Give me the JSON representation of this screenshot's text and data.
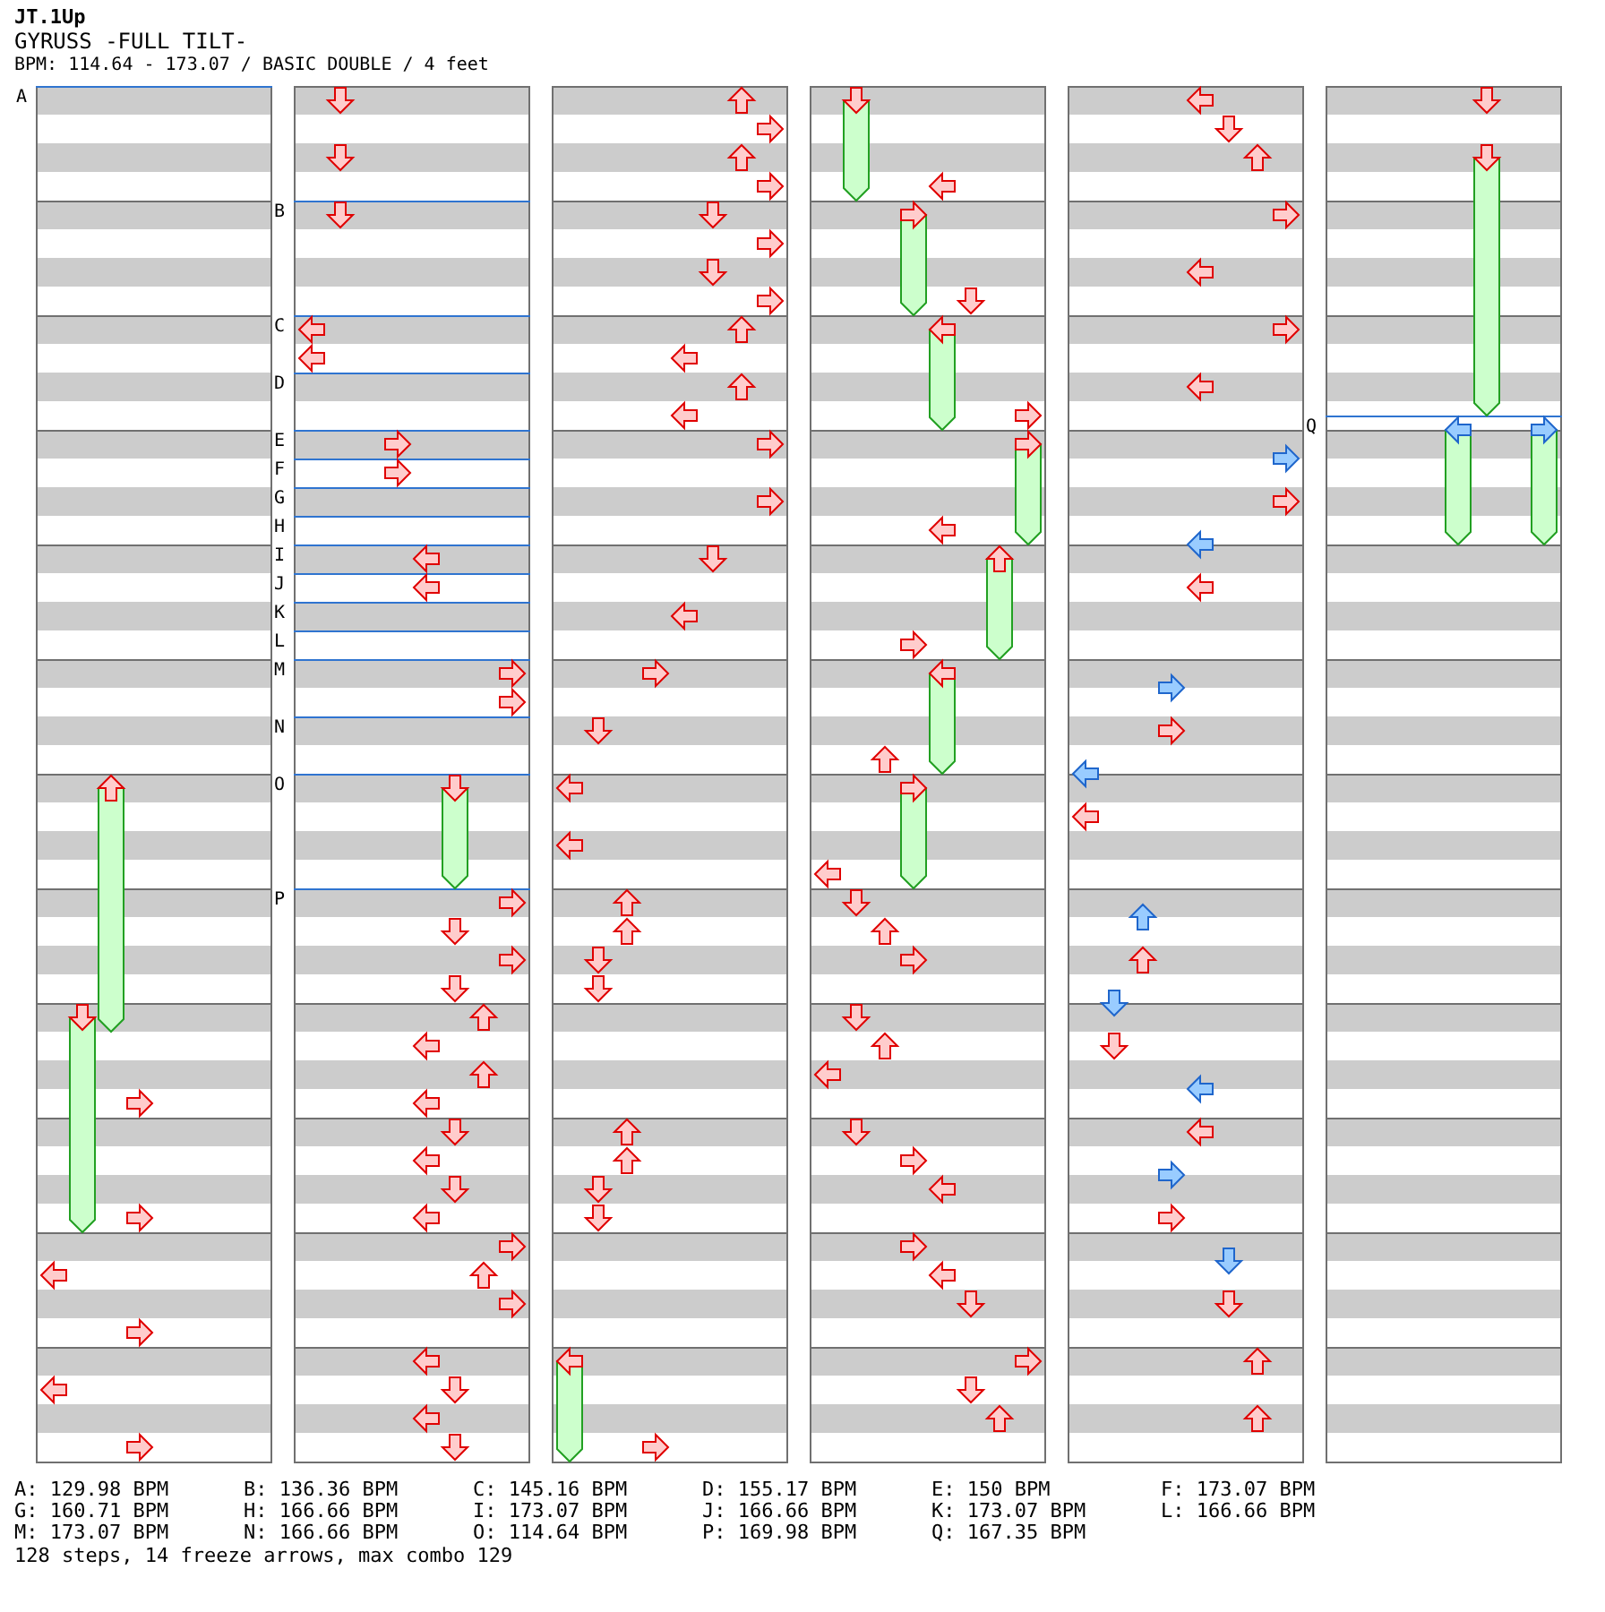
{
  "header": {
    "author": "JT.1Up",
    "title": "GYRUSS -FULL TILT-",
    "info": "BPM: 114.64 - 173.07 / BASIC DOUBLE / 4 feet"
  },
  "columns": [
    {
      "measures": [
        {
          "rows": [
            {
              "bpm_mark": "A"
            },
            {},
            {},
            {},
            {},
            {},
            {},
            {}
          ]
        },
        {
          "rows": [
            {},
            {},
            {},
            {},
            {},
            {},
            {},
            {}
          ]
        },
        {
          "rows": [
            {},
            {},
            {},
            {},
            {},
            {},
            {},
            {}
          ]
        },
        {
          "rows": [
            {},
            {},
            {},
            {},
            {},
            {},
            {},
            {}
          ]
        },
        {
          "rows": [
            {},
            {},
            {},
            {},
            {},
            {},
            {},
            {}
          ]
        },
        {
          "rows": [
            {},
            {},
            {},
            {},
            {},
            {},
            {},
            {}
          ]
        },
        {
          "rows": [
            {
              "p1_up": {
                "kind": "freeze",
                "color": "#ffcccc"
              }
            },
            {},
            {},
            {},
            {},
            {},
            {},
            {}
          ]
        },
        {
          "rows": [
            {},
            {},
            {},
            {},
            {},
            {},
            {},
            {}
          ]
        },
        {
          "rows": [
            {
              "p1_down": {
                "kind": "freeze",
                "color": "#ffcccc"
              },
              "p1_up": {
                "kind": "freeze_end"
              }
            },
            {},
            {},
            {},
            {},
            {},
            {
              "p1_right": {
                "kind": "tap",
                "color": "#ffcccc"
              }
            },
            {}
          ]
        },
        {
          "rows": [
            {},
            {},
            {},
            {},
            {},
            {},
            {
              "p1_down": {
                "kind": "freeze_end"
              },
              "p1_right": {
                "kind": "tap",
                "color": "#ffcccc"
              }
            },
            {}
          ]
        },
        {
          "rows": [
            {},
            {},
            {
              "p1_left": {
                "kind": "tap",
                "color": "#ffcccc"
              }
            },
            {},
            {},
            {},
            {
              "p1_right": {
                "kind": "tap",
                "color": "#ffcccc"
              }
            },
            {}
          ]
        },
        {
          "rows": [
            {},
            {},
            {
              "p1_left": {
                "kind": "tap",
                "color": "#ffcccc"
              }
            },
            {},
            {},
            {},
            {
              "p1_right": {
                "kind": "tap",
                "color": "#ffcccc"
              }
            },
            {}
          ]
        }
      ]
    },
    {
      "measures": [
        {
          "rows": [
            {
              "p1_down": {
                "kind": "tap",
                "color": "#ffcccc"
              }
            },
            {},
            {},
            {},
            {
              "p1_down": {
                "kind": "tap",
                "color": "#ffcccc"
              }
            },
            {},
            {},
            {}
          ]
        },
        {
          "rows": [
            {
              "bpm_mark": "B",
              "p1_down": {
                "kind": "tap",
                "color": "#ffcccc"
              }
            },
            {},
            {},
            {},
            {},
            {},
            {},
            {}
          ]
        },
        {
          "rows": [
            {
              "bpm_mark": "C",
              "p1_left": {
                "kind": "tap",
                "color": "#ffcccc"
              }
            },
            {},
            {
              "p1_left": {
                "kind": "tap",
                "color": "#ffcccc"
              }
            },
            {},
            {
              "bpm_mark": "D"
            },
            {},
            {},
            {}
          ]
        },
        {
          "rows": [
            {
              "bpm_mark": "E",
              "p1_right": {
                "kind": "tap",
                "color": "#ffcccc"
              }
            },
            {},
            {
              "bpm_mark": "F",
              "p1_right": {
                "kind": "tap",
                "color": "#ffcccc"
              }
            },
            {},
            {
              "bpm_mark": "G"
            },
            {},
            {
              "bpm_mark": "H"
            },
            {}
          ]
        },
        {
          "rows": [
            {
              "bpm_mark": "I",
              "p2_left": {
                "kind": "tap",
                "color": "#ffcccc"
              }
            },
            {},
            {
              "bpm_mark": "J",
              "p2_left": {
                "kind": "tap",
                "color": "#ffcccc"
              }
            },
            {},
            {
              "bpm_mark": "K"
            },
            {},
            {
              "bpm_mark": "L"
            },
            {}
          ]
        },
        {
          "rows": [
            {
              "bpm_mark": "M",
              "p2_right": {
                "kind": "tap",
                "color": "#ffcccc"
              }
            },
            {},
            {
              "p2_right": {
                "kind": "tap",
                "color": "#ffcccc"
              }
            },
            {},
            {
              "bpm_mark": "N"
            },
            {},
            {},
            {}
          ]
        },
        {
          "rows": [
            {
              "bpm_mark": "O",
              "p2_down": {
                "kind": "freeze",
                "color": "#ffcccc"
              }
            },
            {},
            {},
            {},
            {},
            {},
            {
              "p2_down": {
                "kind": "freeze_end"
              }
            },
            {}
          ]
        },
        {
          "rows": [
            {
              "bpm_mark": "P",
              "p2_right": {
                "kind": "tap",
                "color": "#ffcccc"
              }
            },
            {},
            {
              "p2_down": {
                "kind": "tap",
                "color": "#ffcccc"
              }
            },
            {},
            {
              "p2_right": {
                "kind": "tap",
                "color": "#ffcccc"
              }
            },
            {},
            {
              "p2_down": {
                "kind": "tap",
                "color": "#ffcccc"
              }
            },
            {}
          ]
        },
        {
          "rows": [
            {
              "p2_up": {
                "kind": "tap",
                "color": "#ffcccc"
              }
            },
            {},
            {
              "p2_left": {
                "kind": "tap",
                "color": "#ffcccc"
              }
            },
            {},
            {
              "p2_up": {
                "kind": "tap",
                "color": "#ffcccc"
              }
            },
            {},
            {
              "p2_left": {
                "kind": "tap",
                "color": "#ffcccc"
              }
            },
            {}
          ]
        },
        {
          "rows": [
            {
              "p2_down": {
                "kind": "tap",
                "color": "#ffcccc"
              }
            },
            {},
            {
              "p2_left": {
                "kind": "tap",
                "color": "#ffcccc"
              }
            },
            {},
            {
              "p2_down": {
                "kind": "tap",
                "color": "#ffcccc"
              }
            },
            {},
            {
              "p2_left": {
                "kind": "tap",
                "color": "#ffcccc"
              }
            },
            {}
          ]
        },
        {
          "rows": [
            {
              "p2_right": {
                "kind": "tap",
                "color": "#ffcccc"
              }
            },
            {},
            {
              "p2_up": {
                "kind": "tap",
                "color": "#ffcccc"
              }
            },
            {},
            {
              "p2_right": {
                "kind": "tap",
                "color": "#ffcccc"
              }
            },
            {},
            {},
            {}
          ]
        },
        {
          "rows": [
            {
              "p2_left": {
                "kind": "tap",
                "color": "#ffcccc"
              }
            },
            {},
            {
              "p2_down": {
                "kind": "tap",
                "color": "#ffcccc"
              }
            },
            {},
            {
              "p2_left": {
                "kind": "tap",
                "color": "#ffcccc"
              }
            },
            {},
            {
              "p2_down": {
                "kind": "tap",
                "color": "#ffcccc"
              }
            },
            {}
          ]
        }
      ]
    },
    {
      "measures": [
        {
          "rows": [
            {
              "p2_up": {
                "kind": "tap",
                "color": "#ffcccc"
              }
            },
            {},
            {
              "p2_right": {
                "kind": "tap",
                "color": "#ffcccc"
              }
            },
            {},
            {
              "p2_up": {
                "kind": "tap",
                "color": "#ffcccc"
              }
            },
            {},
            {
              "p2_right": {
                "kind": "tap",
                "color": "#ffcccc"
              }
            },
            {}
          ]
        },
        {
          "rows": [
            {
              "p2_down": {
                "kind": "tap",
                "color": "#ffcccc"
              }
            },
            {},
            {
              "p2_right": {
                "kind": "tap",
                "color": "#ffcccc"
              }
            },
            {},
            {
              "p2_down": {
                "kind": "tap",
                "color": "#ffcccc"
              }
            },
            {},
            {
              "p2_right": {
                "kind": "tap",
                "color": "#ffcccc"
              }
            },
            {}
          ]
        },
        {
          "rows": [
            {
              "p2_up": {
                "kind": "tap",
                "color": "#ffcccc"
              }
            },
            {},
            {
              "p2_left": {
                "kind": "tap",
                "color": "#ffcccc"
              }
            },
            {},
            {
              "p2_up": {
                "kind": "tap",
                "color": "#ffcccc"
              }
            },
            {},
            {
              "p2_left": {
                "kind": "tap",
                "color": "#ffcccc"
              }
            },
            {}
          ]
        },
        {
          "rows": [
            {
              "p2_right": {
                "kind": "tap",
                "color": "#ffcccc"
              }
            },
            {},
            {},
            {},
            {
              "p2_right": {
                "kind": "tap",
                "color": "#ffcccc"
              }
            },
            {},
            {},
            {}
          ]
        },
        {
          "rows": [
            {
              "p2_down": {
                "kind": "tap",
                "color": "#ffcccc"
              }
            },
            {},
            {},
            {},
            {
              "p2_left": {
                "kind": "tap",
                "color": "#ffcccc"
              }
            },
            {},
            {},
            {}
          ]
        },
        {
          "rows": [
            {
              "p1_right": {
                "kind": "tap",
                "color": "#ffcccc"
              }
            },
            {},
            {},
            {},
            {
              "p1_down": {
                "kind": "tap",
                "color": "#ffcccc"
              }
            },
            {},
            {},
            {}
          ]
        },
        {
          "rows": [
            {
              "p1_left": {
                "kind": "tap",
                "color": "#ffcccc"
              }
            },
            {},
            {},
            {},
            {
              "p1_left": {
                "kind": "tap",
                "color": "#ffcccc"
              }
            },
            {},
            {},
            {}
          ]
        },
        {
          "rows": [
            {
              "p1_up": {
                "kind": "tap",
                "color": "#ffcccc"
              }
            },
            {},
            {
              "p1_up": {
                "kind": "tap",
                "color": "#ffcccc"
              }
            },
            {},
            {
              "p1_down": {
                "kind": "tap",
                "color": "#ffcccc"
              }
            },
            {},
            {
              "p1_down": {
                "kind": "tap",
                "color": "#ffcccc"
              }
            },
            {}
          ]
        },
        {
          "rows": [
            {},
            {},
            {},
            {},
            {},
            {},
            {},
            {}
          ]
        },
        {
          "rows": [
            {
              "p1_up": {
                "kind": "tap",
                "color": "#ffcccc"
              }
            },
            {},
            {
              "p1_up": {
                "kind": "tap",
                "color": "#ffcccc"
              }
            },
            {},
            {
              "p1_down": {
                "kind": "tap",
                "color": "#ffcccc"
              }
            },
            {},
            {
              "p1_down": {
                "kind": "tap",
                "color": "#ffcccc"
              }
            },
            {}
          ]
        },
        {
          "rows": [
            {},
            {},
            {},
            {},
            {},
            {},
            {},
            {}
          ]
        },
        {
          "rows": [
            {
              "p1_left": {
                "kind": "freeze",
                "color": "#ffcccc"
              }
            },
            {},
            {},
            {},
            {},
            {},
            {
              "p1_left": {
                "kind": "freeze_end"
              },
              "p1_right": {
                "kind": "tap",
                "color": "#ffcccc"
              }
            },
            {}
          ]
        }
      ]
    },
    {
      "measures": [
        {
          "rows": [
            {
              "p1_down": {
                "kind": "freeze",
                "color": "#ffcccc"
              }
            },
            {},
            {},
            {},
            {},
            {},
            {
              "p1_down": {
                "kind": "freeze_end"
              },
              "p2_left": {
                "kind": "tap",
                "color": "#ffcccc"
              }
            },
            {}
          ]
        },
        {
          "rows": [
            {
              "p1_right": {
                "kind": "freeze",
                "color": "#ffcccc"
              }
            },
            {},
            {},
            {},
            {},
            {},
            {
              "p1_right": {
                "kind": "freeze_end"
              },
              "p2_down": {
                "kind": "tap",
                "color": "#ffcccc"
              }
            },
            {}
          ]
        },
        {
          "rows": [
            {
              "p2_left": {
                "kind": "freeze",
                "color": "#ffcccc"
              }
            },
            {},
            {},
            {},
            {},
            {},
            {
              "p2_left": {
                "kind": "freeze_end"
              },
              "p2_right": {
                "kind": "tap",
                "color": "#ffcccc"
              }
            },
            {}
          ]
        },
        {
          "rows": [
            {
              "p2_right": {
                "kind": "freeze",
                "color": "#ffcccc"
              }
            },
            {},
            {},
            {},
            {},
            {},
            {
              "p2_right": {
                "kind": "freeze_end"
              },
              "p2_left": {
                "kind": "tap",
                "color": "#ffcccc"
              }
            },
            {}
          ]
        },
        {
          "rows": [
            {
              "p2_up": {
                "kind": "freeze",
                "color": "#ffcccc"
              }
            },
            {},
            {},
            {},
            {},
            {},
            {
              "p2_up": {
                "kind": "freeze_end"
              },
              "p1_right": {
                "kind": "tap",
                "color": "#ffcccc"
              }
            },
            {}
          ]
        },
        {
          "rows": [
            {
              "p2_left": {
                "kind": "freeze",
                "color": "#ffcccc"
              }
            },
            {},
            {},
            {},
            {},
            {},
            {
              "p2_left": {
                "kind": "freeze_end"
              },
              "p1_up": {
                "kind": "tap",
                "color": "#ffcccc"
              }
            },
            {}
          ]
        },
        {
          "rows": [
            {
              "p1_right": {
                "kind": "freeze",
                "color": "#ffcccc"
              }
            },
            {},
            {},
            {},
            {},
            {},
            {
              "p1_right": {
                "kind": "freeze_end"
              },
              "p1_left": {
                "kind": "tap",
                "color": "#ffcccc"
              }
            },
            {}
          ]
        },
        {
          "rows": [
            {
              "p1_down": {
                "kind": "tap",
                "color": "#ffcccc"
              }
            },
            {},
            {
              "p1_up": {
                "kind": "tap",
                "color": "#ffcccc"
              }
            },
            {},
            {
              "p1_right": {
                "kind": "tap",
                "color": "#ffcccc"
              }
            },
            {},
            {},
            {}
          ]
        },
        {
          "rows": [
            {
              "p1_down": {
                "kind": "tap",
                "color": "#ffcccc"
              }
            },
            {},
            {
              "p1_up": {
                "kind": "tap",
                "color": "#ffcccc"
              }
            },
            {},
            {
              "p1_left": {
                "kind": "tap",
                "color": "#ffcccc"
              }
            },
            {},
            {},
            {}
          ]
        },
        {
          "rows": [
            {
              "p1_down": {
                "kind": "tap",
                "color": "#ffcccc"
              }
            },
            {},
            {
              "p1_right": {
                "kind": "tap",
                "color": "#ffcccc"
              }
            },
            {},
            {
              "p2_left": {
                "kind": "tap",
                "color": "#ffcccc"
              }
            },
            {},
            {},
            {}
          ]
        },
        {
          "rows": [
            {
              "p1_right": {
                "kind": "tap",
                "color": "#ffcccc"
              }
            },
            {},
            {
              "p2_left": {
                "kind": "tap",
                "color": "#ffcccc"
              }
            },
            {},
            {
              "p2_down": {
                "kind": "tap",
                "color": "#ffcccc"
              }
            },
            {},
            {},
            {}
          ]
        },
        {
          "rows": [
            {
              "p2_right": {
                "kind": "tap",
                "color": "#ffcccc"
              }
            },
            {},
            {
              "p2_down": {
                "kind": "tap",
                "color": "#ffcccc"
              }
            },
            {},
            {
              "p2_up": {
                "kind": "tap",
                "color": "#ffcccc"
              }
            },
            {},
            {},
            {}
          ]
        }
      ]
    },
    {
      "measures": [
        {
          "rows": [
            {
              "p2_left": {
                "kind": "tap",
                "color": "#ffcccc"
              }
            },
            {},
            {
              "p2_down": {
                "kind": "tap",
                "color": "#ffcccc"
              }
            },
            {},
            {
              "p2_up": {
                "kind": "tap",
                "color": "#ffcccc"
              }
            },
            {},
            {},
            {}
          ]
        },
        {
          "rows": [
            {
              "p2_right": {
                "kind": "tap",
                "color": "#ffcccc"
              }
            },
            {},
            {},
            {},
            {
              "p2_left": {
                "kind": "tap",
                "color": "#ffcccc"
              }
            },
            {},
            {},
            {}
          ]
        },
        {
          "rows": [
            {
              "p2_right": {
                "kind": "tap",
                "color": "#ffcccc"
              }
            },
            {},
            {},
            {},
            {
              "p2_left": {
                "kind": "tap",
                "color": "#ffcccc"
              }
            },
            {},
            {},
            {}
          ]
        },
        {
          "rows": [
            {},
            {
              "p2_right": {
                "kind": "tap",
                "color": "#99ccff"
              }
            },
            {},
            {},
            {
              "p2_right": {
                "kind": "tap",
                "color": "#ffcccc"
              }
            },
            {},
            {},
            {
              "p2_left": {
                "kind": "tap",
                "color": "#99ccff"
              }
            }
          ]
        },
        {
          "rows": [
            {},
            {},
            {
              "p2_left": {
                "kind": "tap",
                "color": "#ffcccc"
              }
            },
            {},
            {},
            {},
            {},
            {}
          ]
        },
        {
          "rows": [
            {},
            {
              "p1_right": {
                "kind": "tap",
                "color": "#99ccff"
              }
            },
            {},
            {},
            {
              "p1_right": {
                "kind": "tap",
                "color": "#ffcccc"
              }
            },
            {},
            {},
            {
              "p1_left": {
                "kind": "tap",
                "color": "#99ccff"
              }
            }
          ]
        },
        {
          "rows": [
            {},
            {},
            {
              "p1_left": {
                "kind": "tap",
                "color": "#ffcccc"
              }
            },
            {},
            {},
            {},
            {},
            {}
          ]
        },
        {
          "rows": [
            {},
            {
              "p1_up": {
                "kind": "tap",
                "color": "#99ccff"
              }
            },
            {},
            {},
            {
              "p1_up": {
                "kind": "tap",
                "color": "#ffcccc"
              }
            },
            {},
            {},
            {
              "p1_down": {
                "kind": "tap",
                "color": "#99ccff"
              }
            }
          ]
        },
        {
          "rows": [
            {},
            {},
            {
              "p1_down": {
                "kind": "tap",
                "color": "#ffcccc"
              }
            },
            {},
            {},
            {
              "p2_left": {
                "kind": "tap",
                "color": "#99ccff"
              }
            },
            {},
            {}
          ]
        },
        {
          "rows": [
            {
              "p2_left": {
                "kind": "tap",
                "color": "#ffcccc"
              }
            },
            {},
            {},
            {
              "p1_right": {
                "kind": "tap",
                "color": "#99ccff"
              }
            },
            {},
            {},
            {
              "p1_right": {
                "kind": "tap",
                "color": "#ffcccc"
              }
            },
            {}
          ]
        },
        {
          "rows": [
            {},
            {
              "p2_down": {
                "kind": "tap",
                "color": "#99ccff"
              }
            },
            {},
            {},
            {
              "p2_down": {
                "kind": "tap",
                "color": "#ffcccc"
              }
            },
            {},
            {},
            {}
          ]
        },
        {
          "rows": [
            {
              "p2_up": {
                "kind": "tap",
                "color": "#ffcccc"
              }
            },
            {},
            {},
            {},
            {
              "p2_up": {
                "kind": "tap",
                "color": "#ffcccc"
              }
            },
            {},
            {},
            {}
          ]
        }
      ]
    },
    {
      "measures": [
        {
          "rows": [
            {
              "p2_down": {
                "kind": "tap",
                "color": "#ffcccc"
              }
            },
            {},
            {},
            {},
            {
              "p2_down": {
                "kind": "freeze",
                "color": "#ffcccc"
              }
            },
            {},
            {},
            {}
          ]
        },
        {
          "rows": [
            {},
            {},
            {},
            {},
            {},
            {},
            {},
            {}
          ]
        },
        {
          "rows": [
            {},
            {},
            {},
            {},
            {},
            {
              "p2_down": {
                "kind": "freeze_end"
              }
            },
            {},
            {
              "bpm_mark": "Q",
              "p2_left": {
                "kind": "freeze",
                "color": "#99ccff"
              },
              "p2_right": {
                "kind": "freeze",
                "color": "#99ccff"
              }
            }
          ]
        },
        {
          "rows": [
            {},
            {},
            {},
            {},
            {},
            {},
            {
              "p2_left": {
                "kind": "freeze_end"
              },
              "p2_right": {
                "kind": "freeze_end"
              }
            },
            {}
          ]
        },
        {
          "rows": [
            {},
            {},
            {},
            {},
            {},
            {},
            {},
            {}
          ]
        },
        {
          "rows": [
            {},
            {},
            {},
            {},
            {},
            {},
            {},
            {}
          ]
        },
        {
          "rows": [
            {},
            {},
            {},
            {},
            {},
            {},
            {},
            {}
          ]
        },
        {
          "rows": [
            {},
            {},
            {},
            {},
            {},
            {},
            {},
            {}
          ]
        },
        {
          "rows": [
            {},
            {},
            {},
            {},
            {},
            {},
            {},
            {}
          ]
        },
        {
          "rows": [
            {},
            {},
            {},
            {},
            {},
            {},
            {},
            {}
          ]
        },
        {
          "rows": [
            {},
            {},
            {},
            {},
            {},
            {},
            {},
            {}
          ]
        },
        {
          "rows": [
            {},
            {},
            {},
            {},
            {},
            {},
            {},
            {}
          ]
        }
      ]
    }
  ],
  "bpm_list": [
    "A: 129.98 BPM",
    "B: 136.36 BPM",
    "C: 145.16 BPM",
    "D: 155.17 BPM",
    "E: 150 BPM",
    "F: 173.07 BPM",
    "G: 160.71 BPM",
    "H: 166.66 BPM",
    "I: 173.07 BPM",
    "J: 166.66 BPM",
    "K: 173.07 BPM",
    "L: 166.66 BPM",
    "M: 173.07 BPM",
    "N: 166.66 BPM",
    "O: 114.64 BPM",
    "P: 169.98 BPM",
    "Q: 167.35 BPM"
  ],
  "summary": "128 steps, 14 freeze arrows, max combo 129"
}
